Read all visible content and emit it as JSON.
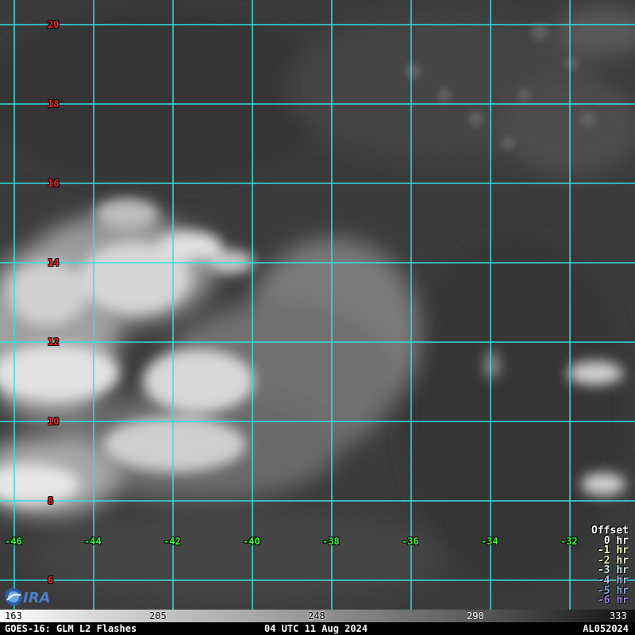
{
  "map": {
    "lat_labels": [
      "20",
      "18",
      "16",
      "14",
      "12",
      "10",
      "8",
      "6"
    ],
    "lon_labels": [
      "-46",
      "-44",
      "-42",
      "-40",
      "-38",
      "-36",
      "-34",
      "-32"
    ],
    "grid_color": "#30e0e0",
    "lat_label_color": "#ff2020",
    "lon_label_color": "#33ff33",
    "logo": "cira-logo"
  },
  "offset_legend": {
    "title": "Offset",
    "items": [
      {
        "label": "0 hr",
        "color": "#ffffff"
      },
      {
        "label": "-1 hr",
        "color": "#ffffc0"
      },
      {
        "label": "-2 hr",
        "color": "#e8f0c8"
      },
      {
        "label": "-3 hr",
        "color": "#c8e6e6"
      },
      {
        "label": "-4 hr",
        "color": "#a8c8e8"
      },
      {
        "label": "-5 hr",
        "color": "#8aa6e0"
      },
      {
        "label": "-6 hr",
        "color": "#9c84d8"
      }
    ]
  },
  "colorbar": {
    "ticks": [
      "163",
      "205",
      "248",
      "290",
      "333"
    ]
  },
  "footer": {
    "left": "GOES-16: GLM L2 Flashes",
    "center": "04 UTC 11 Aug 2024",
    "right": "AL052024"
  }
}
